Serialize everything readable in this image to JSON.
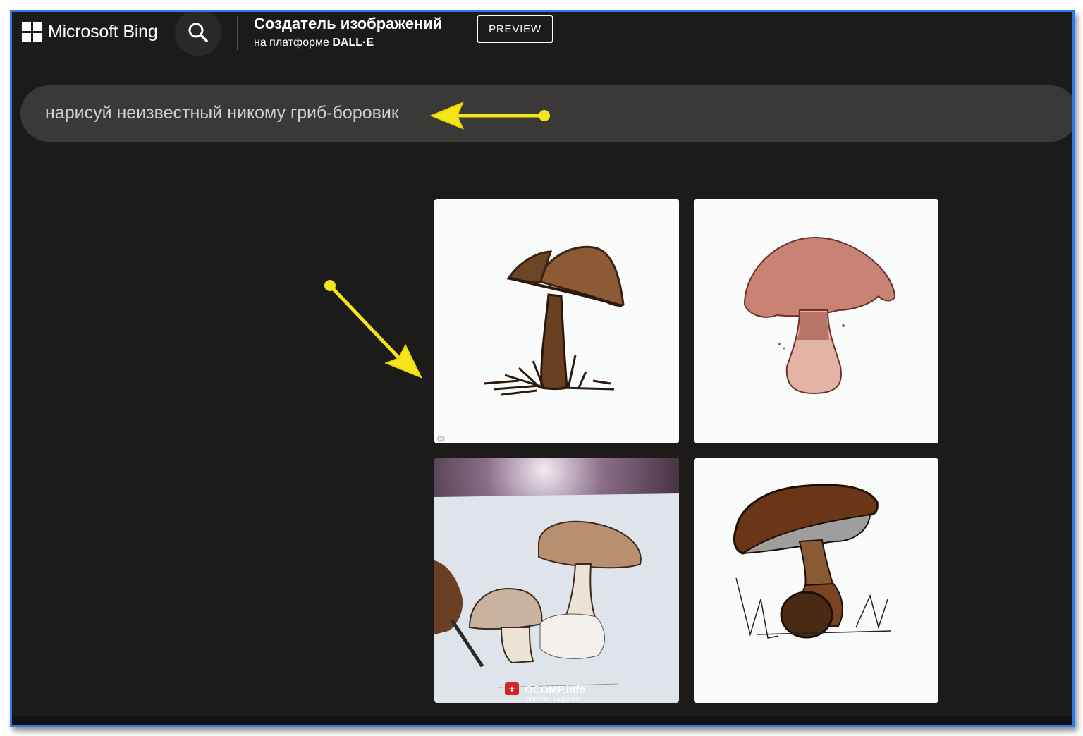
{
  "header": {
    "brand": "Microsoft Bing",
    "title": "Создатель изображений",
    "subtitle_prefix": "на платформе ",
    "subtitle_platform": "DALL·E",
    "preview_label": "PREVIEW"
  },
  "prompt": {
    "text": "нарисуй неизвестный никому гриб-боровик"
  },
  "results": {
    "watermark": {
      "site": "OCOMP.info",
      "tagline": "ВОПРОСЫ АДМИНУ"
    }
  },
  "icons": {
    "logo": "windows-logo-icon",
    "search": "search-icon",
    "annotation": "yellow-arrow-icon"
  },
  "colors": {
    "background": "#1c1b1a",
    "prompt_bar": "#3a3938",
    "frame_border": "#2d7be6",
    "annotation_arrow": "#f5e51b"
  }
}
